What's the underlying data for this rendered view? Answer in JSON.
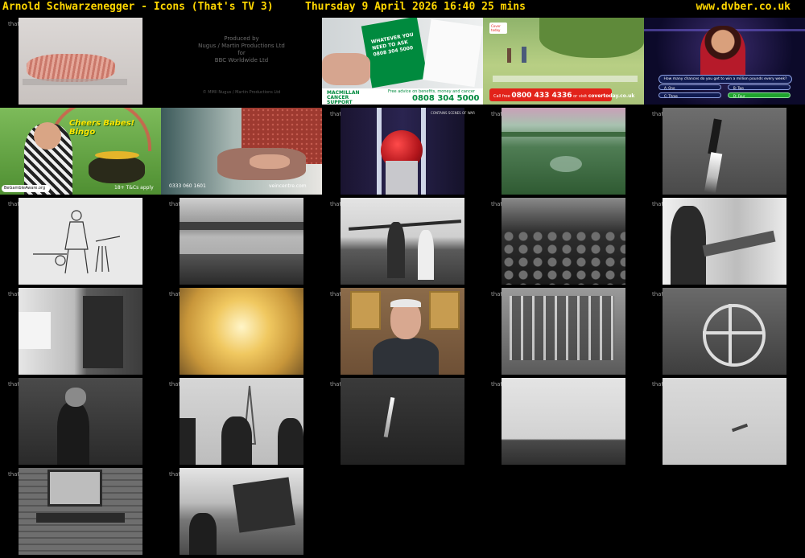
{
  "header": {
    "title": "Arnold Schwarzenegger - Icons (That's TV 3)",
    "datetime": "Thursday 9 April 2026  16:40  25 mins",
    "site": "www.dvber.co.uk"
  },
  "channel_logo": "that's",
  "frames": [
    {
      "kind": "photo"
    },
    {
      "kind": "credits",
      "lines": [
        "Produced by",
        "Nugus / Martin Productions Ltd",
        "for",
        "BBC Worldwide Ltd"
      ],
      "copyright": "© MMII Nugus / Martin Productions Ltd"
    },
    {
      "kind": "ad-macmillan",
      "leaflet": "WHATEVER YOU NEED TO ASK 0808 304 5000",
      "brand": "MACMILLAN CANCER SUPPORT",
      "tagline": "Free advice on benefits, money and cancer",
      "phone": "0808 304 5000"
    },
    {
      "kind": "ad-cover",
      "brand": "Cover today",
      "call": "Call free",
      "phone": "0800 433 4336",
      "or": "or visit",
      "url": "covertoday.co.uk"
    },
    {
      "kind": "quiz",
      "question": "How many chances do you get to win a million pounds every week?",
      "options": [
        "A: One",
        "B: Two",
        "C: Three",
        "D: Four"
      ]
    },
    {
      "kind": "ad-bingo",
      "headline": "Cheers Babes! Bingo",
      "badge": "BeGambleAware.org",
      "terms": "18+ T&Cs apply"
    },
    {
      "kind": "ad-vein",
      "phone": "0333 060 1601",
      "url": "veincentre.com"
    },
    {
      "kind": "rocket",
      "caption": "CONTAINS SCENES OF WAR"
    },
    {
      "kind": "landscape"
    },
    {
      "kind": "v2-launch"
    },
    {
      "kind": "drawing"
    },
    {
      "kind": "bw"
    },
    {
      "kind": "bw"
    },
    {
      "kind": "bw"
    },
    {
      "kind": "bw"
    },
    {
      "kind": "bw"
    },
    {
      "kind": "explosion"
    },
    {
      "kind": "interview"
    },
    {
      "kind": "bw"
    },
    {
      "kind": "bw"
    },
    {
      "kind": "bw"
    },
    {
      "kind": "bw-eiffel"
    },
    {
      "kind": "bw-rocket"
    },
    {
      "kind": "bw-sky"
    },
    {
      "kind": "bw-sky"
    },
    {
      "kind": "bw"
    },
    {
      "kind": "bw"
    }
  ],
  "colors": {
    "header_text": "#ffd700",
    "background": "#000000",
    "macmillan_green": "#008a3e",
    "cover_red": "#e2231a"
  }
}
